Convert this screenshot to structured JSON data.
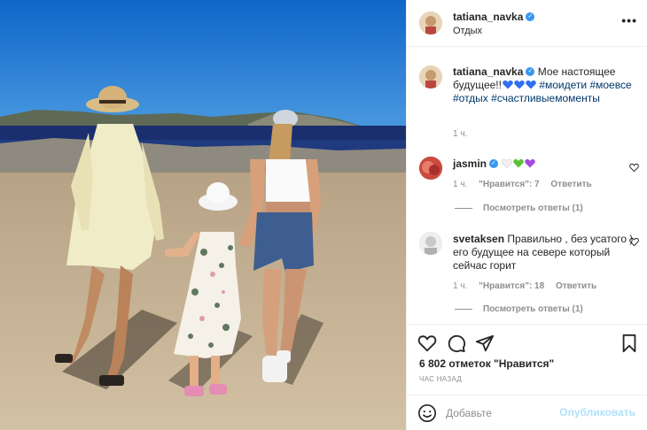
{
  "header": {
    "username": "tatiana_navka",
    "location": "Отдых",
    "more_glyph": "•••"
  },
  "caption": {
    "username": "tatiana_navka",
    "text": "Мое настоящее будущее!!",
    "hashtags": [
      "#моидети",
      "#моевсе",
      "#отдых",
      "#счастливыемоменты"
    ],
    "time": "1 ч."
  },
  "comments": [
    {
      "username": "jasmin",
      "text": "",
      "time": "1 ч.",
      "likes": "\"Нравится\": 7",
      "reply": "Ответить",
      "view_replies": "Посмотреть ответы (1)"
    },
    {
      "username": "svetaksen",
      "text": "Правильно , без усатого ) его будущее на севере который сейчас горит",
      "time": "1 ч.",
      "likes": "\"Нравится\": 18",
      "reply": "Ответить",
      "view_replies": "Посмотреть ответы (1)"
    }
  ],
  "icons": [
    "more-icon",
    "verified-icon",
    "heart-icon",
    "comment-icon",
    "share-icon",
    "bookmark-icon",
    "emoji-icon"
  ],
  "likes_text": "6 802 отметок \"Нравится\"",
  "time_ago": "ЧАС НАЗАД",
  "add_comment": {
    "placeholder": "Добавьте",
    "publish_label": "Опубликовать"
  },
  "colors": {
    "link": "#00376b",
    "verified": "#3897f0",
    "muted": "#8e8e8e",
    "publish_disabled": "#b2dffc",
    "heart_blue": "#2f6ff0",
    "heart_white": "#f2f2f2",
    "heart_green": "#5cc13a",
    "heart_purple": "#a64ae0"
  }
}
